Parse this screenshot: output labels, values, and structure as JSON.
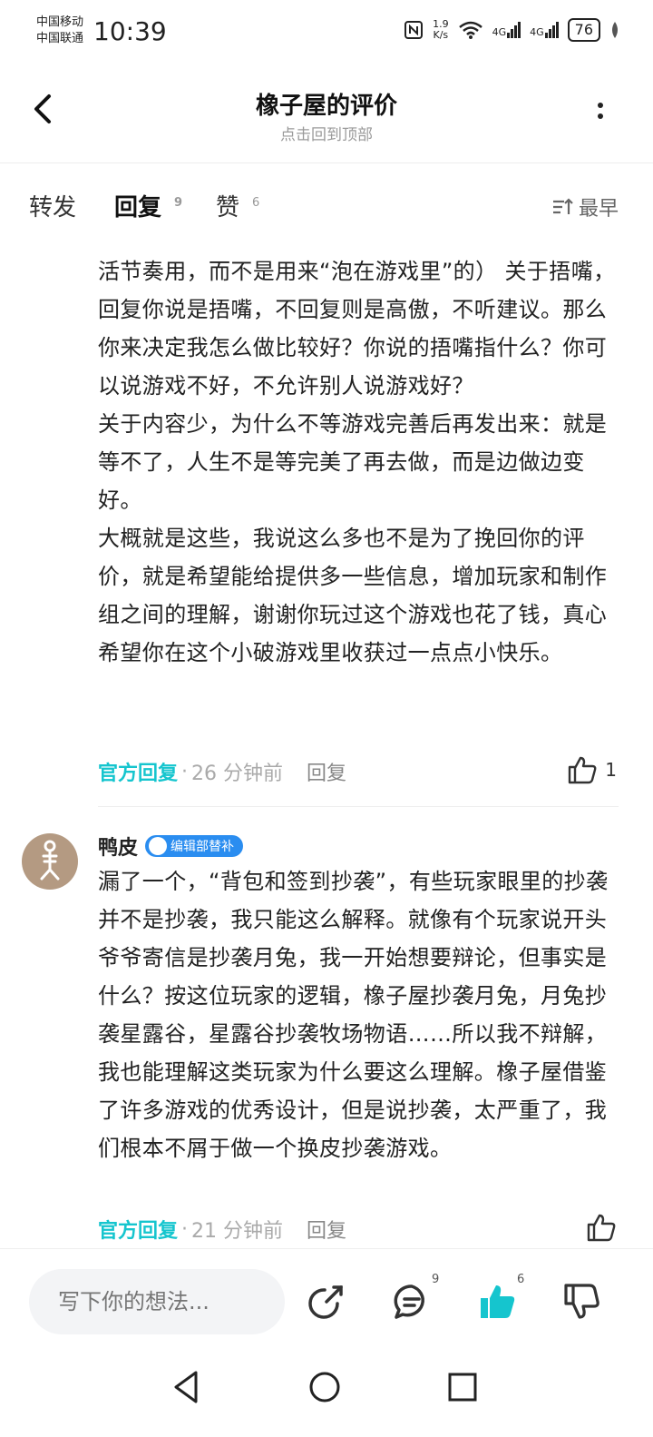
{
  "status": {
    "carrier1": "中国移动",
    "carrier2": "中国联通",
    "time": "10:39",
    "net_speed_value": "1.9",
    "net_speed_unit": "K/s",
    "signal1": "4G",
    "signal2": "4G",
    "battery": "76"
  },
  "header": {
    "title": "橡子屋的评价",
    "subtitle": "点击回到顶部"
  },
  "tabs": [
    {
      "label": "转发",
      "count": ""
    },
    {
      "label": "回复",
      "count": "9"
    },
    {
      "label": "赞",
      "count": "6"
    }
  ],
  "sort_label": "最早",
  "reply1": {
    "paragraphs": [
      "活节奏用，而不是用来“泡在游戏里”的） 关于捂嘴，回复你说是捂嘴，不回复则是高傲，不听建议。那么你来决定我怎么做比较好？你说的捂嘴指什么？你可以说游戏不好，不允许别人说游戏好？",
      "关于内容少，为什么不等游戏完善后再发出来：就是等不了，人生不是等完美了再去做，而是边做边变好。",
      "大概就是这些，我说这么多也不是为了挽回你的评价，就是希望能给提供多一些信息，增加玩家和制作组之间的理解，谢谢你玩过这个游戏也花了钱，真心希望你在这个小破游戏里收获过一点点小快乐。"
    ],
    "official_label": "官方回复",
    "time": "26 分钟前",
    "reply_label": "回复",
    "likes": "1"
  },
  "reply2": {
    "username": "鸭皮",
    "badge": "编辑部替补",
    "text": "漏了一个，“背包和签到抄袭”，有些玩家眼里的抄袭并不是抄袭，我只能这么解释。就像有个玩家说开头爷爷寄信是抄袭月兔，我一开始想要辩论，但事实是什么？按这位玩家的逻辑，橡子屋抄袭月兔，月兔抄袭星露谷，星露谷抄袭牧场物语……所以我不辩解，我也能理解这类玩家为什么要这么理解。橡子屋借鉴了许多游戏的优秀设计，但是说抄袭，太严重了，我们根本不屑于做一个换皮抄袭游戏。",
    "official_label": "官方回复",
    "time": "21 分钟前",
    "reply_label": "回复",
    "likes": ""
  },
  "bottom": {
    "input_placeholder": "写下你的想法...",
    "comment_count": "9",
    "like_count": "6"
  },
  "colors": {
    "accent": "#15c5ce",
    "badge": "#2a8df0"
  }
}
